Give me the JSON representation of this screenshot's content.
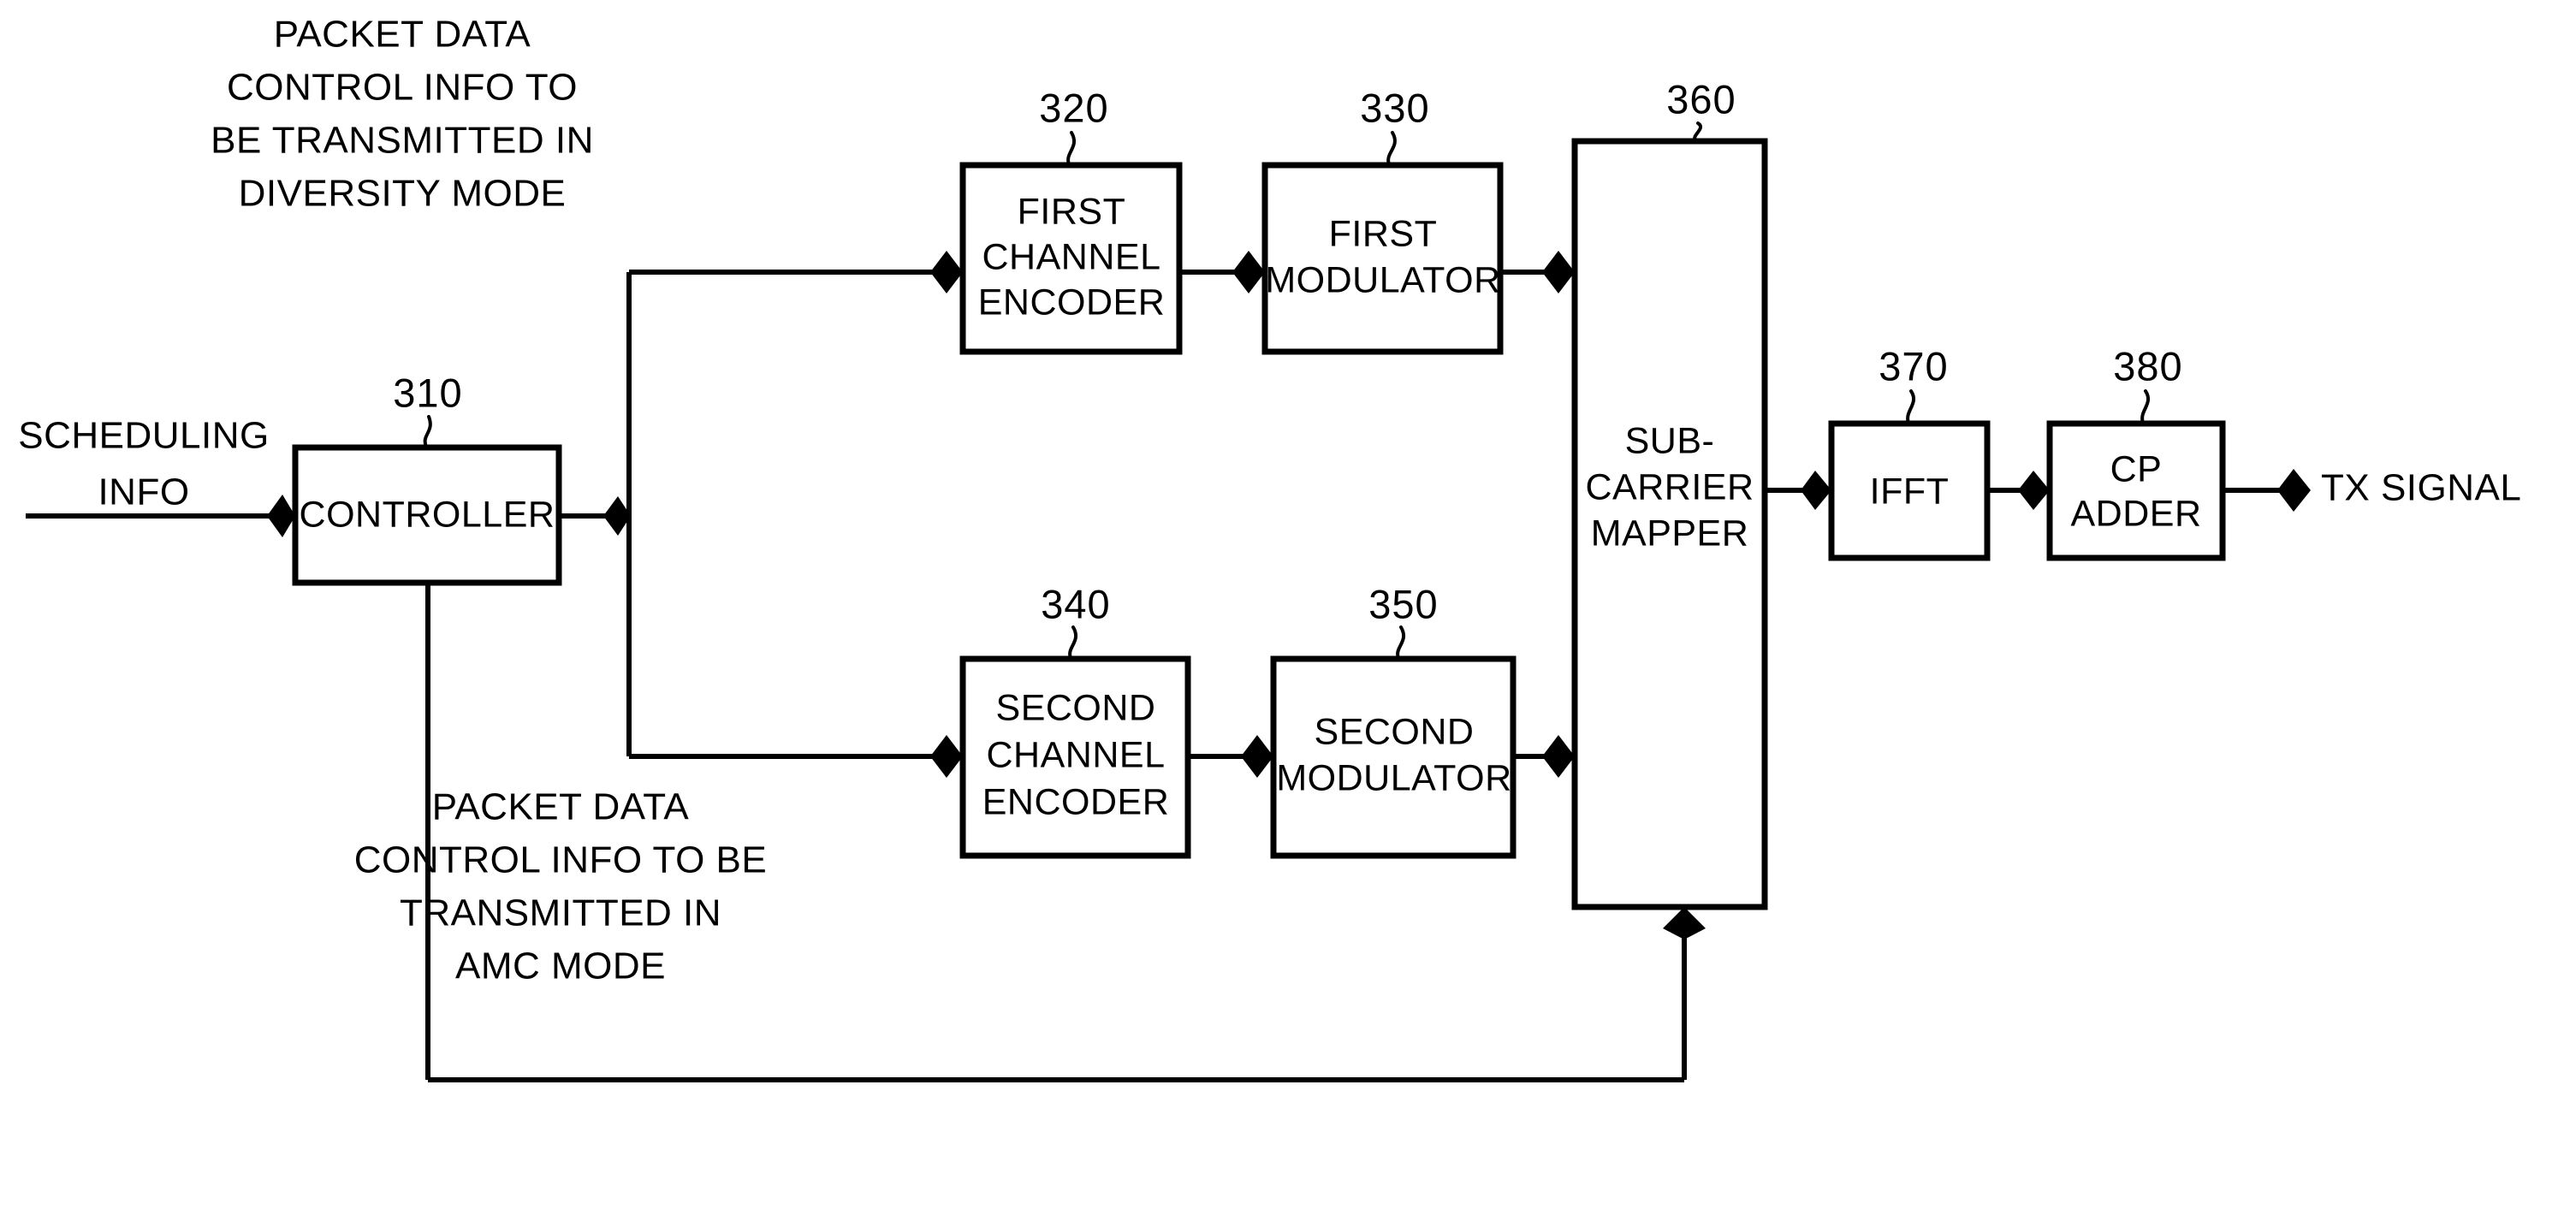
{
  "figure": {
    "kind": "patent-block-diagram",
    "ink_color": "#000000",
    "background_color": "#ffffff"
  },
  "blocks": [
    {
      "id": "controller",
      "ref": "310",
      "lines": [
        "CONTROLLER"
      ]
    },
    {
      "id": "first_channel_encoder",
      "ref": "320",
      "lines": [
        "FIRST",
        "CHANNEL",
        "ENCODER"
      ]
    },
    {
      "id": "first_modulator",
      "ref": "330",
      "lines": [
        "FIRST",
        "MODULATOR"
      ]
    },
    {
      "id": "second_channel_encoder",
      "ref": "340",
      "lines": [
        "SECOND",
        "CHANNEL",
        "ENCODER"
      ]
    },
    {
      "id": "second_modulator",
      "ref": "350",
      "lines": [
        "SECOND",
        "MODULATOR"
      ]
    },
    {
      "id": "subcarrier_mapper",
      "ref": "360",
      "lines": [
        "SUB-",
        "CARRIER",
        "MAPPER"
      ]
    },
    {
      "id": "ifft",
      "ref": "370",
      "lines": [
        "IFFT"
      ]
    },
    {
      "id": "cp_adder",
      "ref": "380",
      "lines": [
        "CP",
        "ADDER"
      ]
    }
  ],
  "labels": {
    "scheduling_info": [
      "SCHEDULING",
      "INFO"
    ],
    "diversity_input": [
      "PACKET DATA",
      "CONTROL INFO TO",
      "BE TRANSMITTED IN",
      "DIVERSITY MODE"
    ],
    "amc_input": [
      "PACKET DATA",
      "CONTROL INFO TO BE",
      "TRANSMITTED IN",
      "AMC MODE"
    ],
    "tx_signal": "TX SIGNAL"
  },
  "refs": {
    "controller": "310",
    "first_channel_encoder": "320",
    "first_modulator": "330",
    "second_channel_encoder": "340",
    "second_modulator": "350",
    "subcarrier_mapper": "360",
    "ifft": "370",
    "cp_adder": "380"
  },
  "box_text": {
    "controller": "CONTROLLER",
    "fce_l1": "FIRST",
    "fce_l2": "CHANNEL",
    "fce_l3": "ENCODER",
    "fm_l1": "FIRST",
    "fm_l2": "MODULATOR",
    "sce_l1": "SECOND",
    "sce_l2": "CHANNEL",
    "sce_l3": "ENCODER",
    "sm_l1": "SECOND",
    "sm_l2": "MODULATOR",
    "scm_l1": "SUB-",
    "scm_l2": "CARRIER",
    "scm_l3": "MAPPER",
    "ifft": "IFFT",
    "cp_l1": "CP",
    "cp_l2": "ADDER"
  },
  "text_lines": {
    "sched_l1": "SCHEDULING",
    "sched_l2": "INFO",
    "div_l1": "PACKET DATA",
    "div_l2": "CONTROL INFO TO",
    "div_l3": "BE TRANSMITTED IN",
    "div_l4": "DIVERSITY MODE",
    "amc_l1": "PACKET DATA",
    "amc_l2": "CONTROL INFO TO BE",
    "amc_l3": "TRANSMITTED IN",
    "amc_l4": "AMC MODE",
    "tx_signal": "TX SIGNAL"
  }
}
